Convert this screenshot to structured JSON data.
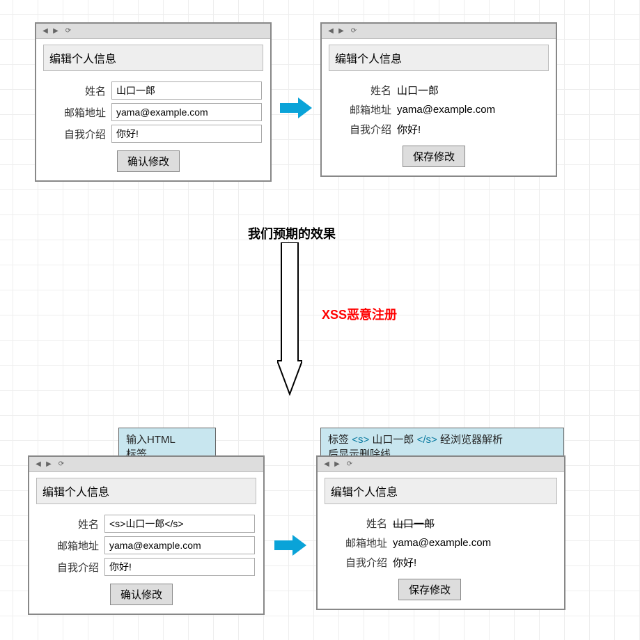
{
  "labels": {
    "expected": "我们预期的效果",
    "xss": "XSS恶意注册"
  },
  "bubbles": {
    "left": {
      "line1": "输入HTML",
      "line2": "标签"
    },
    "right": {
      "pre": "标签",
      "tag_open": "<s>",
      "name": "山口一郎",
      "tag_close": "</s>",
      "post": "经浏览器解析",
      "line2": "后显示删除线"
    }
  },
  "windows": {
    "topLeft": {
      "title": "编辑个人信息",
      "fields": {
        "name": {
          "label": "姓名",
          "value": "山口一郎"
        },
        "email": {
          "label": "邮箱地址",
          "value": "yama@example.com"
        },
        "bio": {
          "label": "自我介绍",
          "value": "你好!"
        }
      },
      "button": "确认修改"
    },
    "topRight": {
      "title": "编辑个人信息",
      "fields": {
        "name": {
          "label": "姓名",
          "value": "山口一郎"
        },
        "email": {
          "label": "邮箱地址",
          "value": "yama@example.com"
        },
        "bio": {
          "label": "自我介绍",
          "value": "你好!"
        }
      },
      "button": "保存修改"
    },
    "bottomLeft": {
      "title": "编辑个人信息",
      "fields": {
        "name": {
          "label": "姓名",
          "value": "<s>山口一郎</s>"
        },
        "email": {
          "label": "邮箱地址",
          "value": "yama@example.com"
        },
        "bio": {
          "label": "自我介绍",
          "value": "你好!"
        }
      },
      "button": "确认修改"
    },
    "bottomRight": {
      "title": "编辑个人信息",
      "fields": {
        "name": {
          "label": "姓名",
          "value": "山口一郎"
        },
        "email": {
          "label": "邮箱地址",
          "value": "yama@example.com"
        },
        "bio": {
          "label": "自我介绍",
          "value": "你好!"
        }
      },
      "button": "保存修改"
    }
  }
}
